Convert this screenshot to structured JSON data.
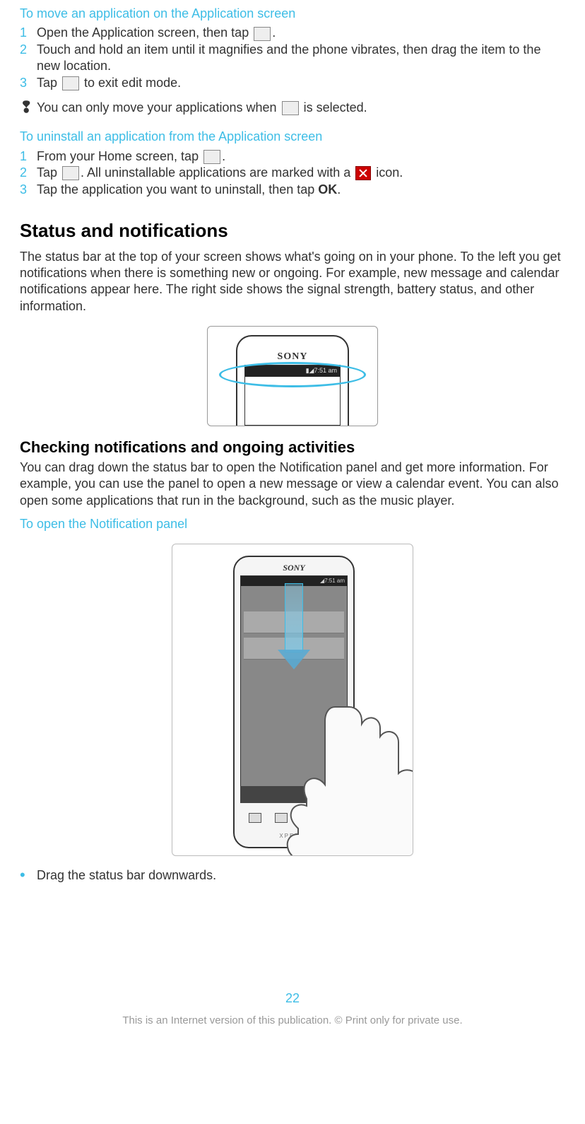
{
  "sec1": {
    "heading": "To move an application on the Application screen",
    "steps": [
      {
        "num": "1",
        "pre": "Open the Application screen, then tap ",
        "post": "."
      },
      {
        "num": "2",
        "text": "Touch and hold an item until it magnifies and the phone vibrates, then drag the item to the new location."
      },
      {
        "num": "3",
        "pre": "Tap ",
        "post": " to exit edit mode."
      }
    ],
    "note_pre": "You can only move your applications when ",
    "note_post": " is selected."
  },
  "sec2": {
    "heading": "To uninstall an application from the Application screen",
    "steps": [
      {
        "num": "1",
        "pre": "From your Home screen, tap ",
        "post": "."
      },
      {
        "num": "2",
        "pre": "Tap ",
        "mid": ". All uninstallable applications are marked with a ",
        "post": " icon."
      },
      {
        "num": "3",
        "pre": "Tap the application you want to uninstall, then tap ",
        "bold": "OK",
        "post": "."
      }
    ]
  },
  "status": {
    "heading": "Status and notifications",
    "body": "The status bar at the top of your screen shows what's going on in your phone. To the left you get notifications when there is something new or ongoing. For example, new message and calendar notifications appear here. The right side shows the signal strength, battery status, and other information.",
    "fig_time": "7:51 am",
    "brand": "SONY"
  },
  "checking": {
    "heading": "Checking notifications and ongoing activities",
    "body": "You can drag down the status bar to open the Notification panel and get more information. For example, you can use the panel to open a new message or view a calendar event. You can also open some applications that run in the background, such as the music player.",
    "subheading": "To open the Notification panel",
    "brand": "SONY",
    "fig_time": "7:51 am",
    "xperia": "XPERIA",
    "bullet": "Drag the status bar downwards."
  },
  "footer": {
    "page": "22",
    "disclaimer": "This is an Internet version of this publication. © Print only for private use."
  }
}
